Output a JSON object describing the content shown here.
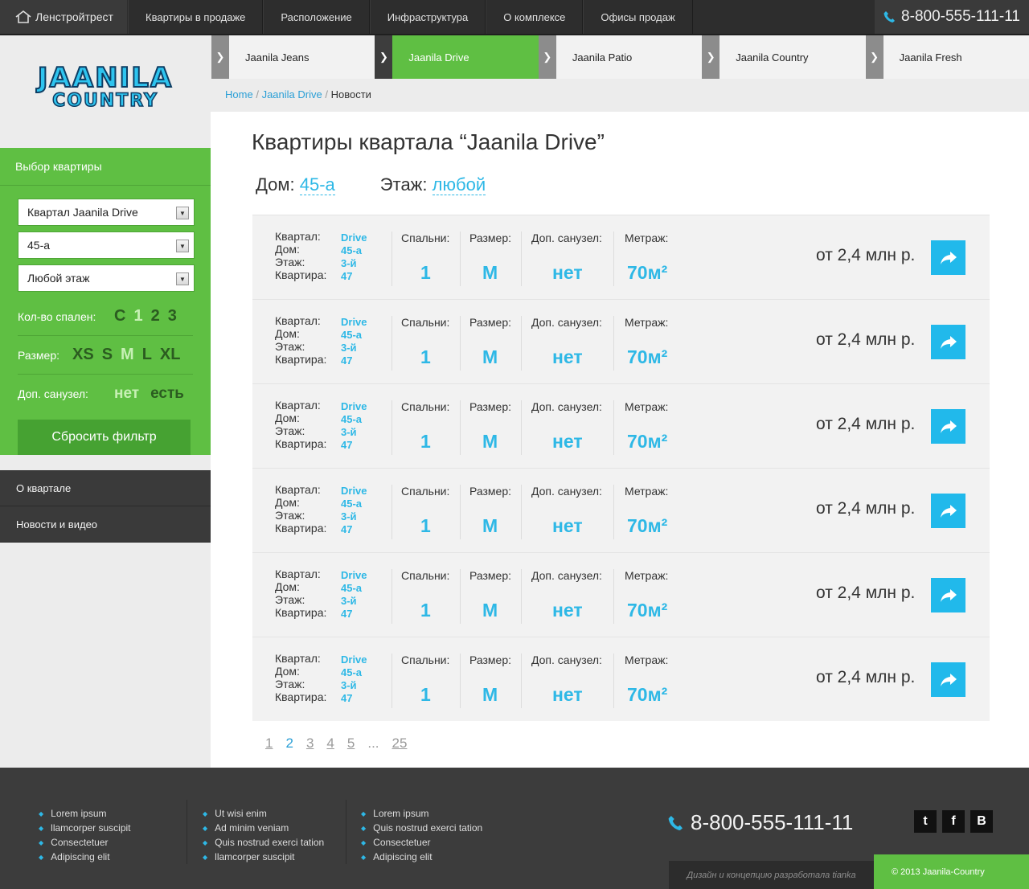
{
  "topbar": {
    "brand": "Ленстройтрест",
    "nav": [
      "Квартиры в продаже",
      "Расположение",
      "Инфраструктура",
      "О комплексе",
      "Офисы продаж"
    ],
    "phone": "8-800-555-111-11"
  },
  "logo": {
    "line1": "JAANILA",
    "line2": "COUNTRY"
  },
  "filter": {
    "title": "Выбор квартиры",
    "selects": [
      "Квартал Jaanila Drive",
      "45-а",
      "Любой этаж"
    ],
    "bedrooms_label": "Кол-во спален:",
    "bedrooms": [
      "С",
      "1",
      "2",
      "3"
    ],
    "size_label": "Размер:",
    "sizes": [
      "XS",
      "S",
      "M",
      "L",
      "XL"
    ],
    "bath_label": "Доп. санузел:",
    "bath": [
      "нет",
      "есть"
    ],
    "reset": "Сбросить фильтр"
  },
  "sidenav": [
    "О квартале",
    "Новости и видео"
  ],
  "districts": [
    "Jaanila Jeans",
    "Jaanila Drive",
    "Jaanila Patio",
    "Jaanila Country",
    "Jaanila Fresh"
  ],
  "breadcrumb": {
    "home": "Home",
    "sep": "/",
    "section": "Jaanila Drive",
    "current": "Новости"
  },
  "main": {
    "title": "Квартиры квартала “Jaanila Drive”",
    "house_label": "Дом:",
    "house_value": "45-а",
    "floor_label": "Этаж:",
    "floor_value": "любой"
  },
  "labels": {
    "kvartal": "Квартал:",
    "dom": "Дом:",
    "etazh": "Этаж:",
    "kvartira": "Квартира:",
    "bedrooms": "Спальни:",
    "size": "Размер:",
    "bath": "Доп. санузел:",
    "area": "Метраж:"
  },
  "apartments": [
    {
      "kvartal": "Drive",
      "dom": "45-а",
      "etazh": "3-й",
      "kvartira": "47",
      "bedrooms": "1",
      "size": "M",
      "bath": "нет",
      "area": "70м²",
      "price": "от 2,4 млн р."
    },
    {
      "kvartal": "Drive",
      "dom": "45-а",
      "etazh": "3-й",
      "kvartira": "47",
      "bedrooms": "1",
      "size": "M",
      "bath": "нет",
      "area": "70м²",
      "price": "от 2,4 млн р."
    },
    {
      "kvartal": "Drive",
      "dom": "45-а",
      "etazh": "3-й",
      "kvartira": "47",
      "bedrooms": "1",
      "size": "M",
      "bath": "нет",
      "area": "70м²",
      "price": "от 2,4 млн р."
    },
    {
      "kvartal": "Drive",
      "dom": "45-а",
      "etazh": "3-й",
      "kvartira": "47",
      "bedrooms": "1",
      "size": "M",
      "bath": "нет",
      "area": "70м²",
      "price": "от 2,4 млн р."
    },
    {
      "kvartal": "Drive",
      "dom": "45-а",
      "etazh": "3-й",
      "kvartira": "47",
      "bedrooms": "1",
      "size": "M",
      "bath": "нет",
      "area": "70м²",
      "price": "от 2,4 млн р."
    },
    {
      "kvartal": "Drive",
      "dom": "45-а",
      "etazh": "3-й",
      "kvartira": "47",
      "bedrooms": "1",
      "size": "M",
      "bath": "нет",
      "area": "70м²",
      "price": "от 2,4 млн р."
    }
  ],
  "pager": [
    "1",
    "2",
    "3",
    "4",
    "5",
    "...",
    "25"
  ],
  "footer": {
    "col1": [
      "Lorem ipsum",
      "llamcorper suscipit",
      "Consectetuer",
      "Adipiscing elit"
    ],
    "col2": [
      "Ut wisi enim",
      "Ad minim veniam",
      "Quis nostrud exerci tation",
      "llamcorper suscipit"
    ],
    "col3": [
      "Lorem ipsum",
      "Quis nostrud exerci tation",
      "Consectetuer",
      "Adipiscing elit"
    ],
    "phone": "8-800-555-111-11",
    "social": [
      "t",
      "f",
      "B"
    ],
    "credit": "Дизайн и концепцию разработала tianka",
    "copyright": "© 2013 Jaanila-Country"
  },
  "colors": {
    "green": "#5fbf43",
    "blue": "#2eb8e6",
    "dark": "#2d2d2d"
  }
}
